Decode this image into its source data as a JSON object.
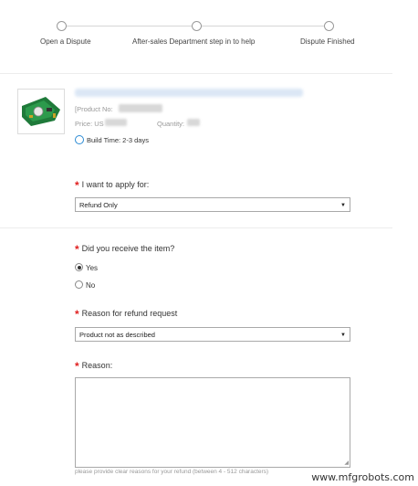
{
  "steps": [
    "Open a Dispute",
    "After-sales Department step in to help",
    "Dispute Finished"
  ],
  "product": {
    "number_label": "[Product No:",
    "price_label": "Price: US",
    "quantity_label": "Quantity:",
    "build_time": "Build Time: 2-3 days"
  },
  "form": {
    "apply_label": "I want to apply for:",
    "apply_value": "Refund Only",
    "received_label": "Did you receive the item?",
    "received_options": [
      "Yes",
      "No"
    ],
    "received_selected": "Yes",
    "reason_request_label": "Reason for refund request",
    "reason_request_value": "Product not as described",
    "reason_label": "Reason:",
    "reason_hint": "please provide clear reasons for your refund (between 4 - 512 characters)"
  },
  "watermark": "www.mfgrobots.com",
  "icons": {
    "build": "clock-refresh-icon",
    "dropdown": "chevron-down-icon",
    "resize": "resize-handle-icon"
  },
  "colors": {
    "required": "#e02020",
    "accent": "#2a8ad4"
  }
}
